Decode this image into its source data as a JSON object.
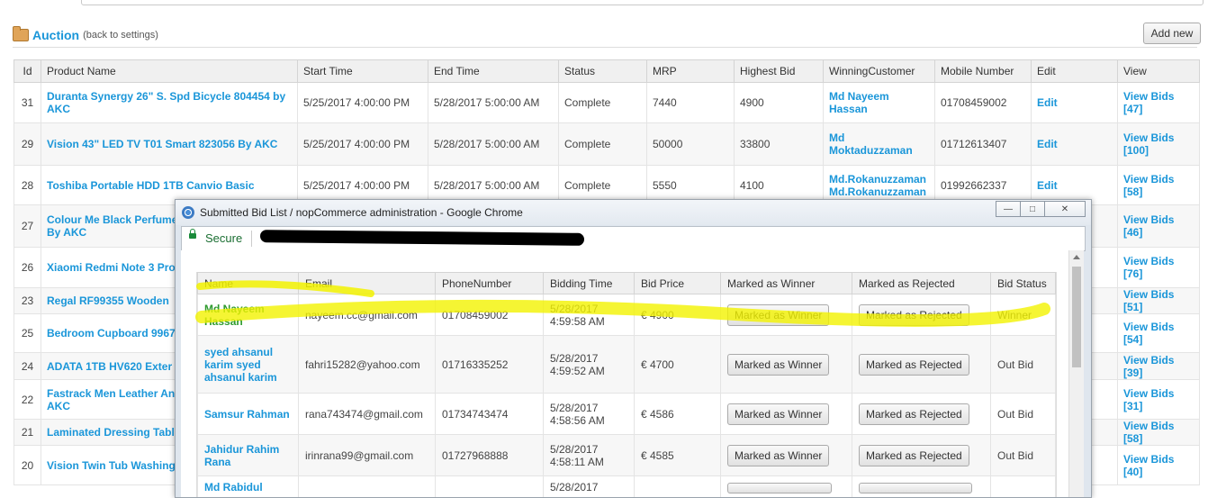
{
  "header": {
    "title": "Auction",
    "back_link": "(back to settings)",
    "add_new": "Add new"
  },
  "main_table": {
    "columns": [
      "Id",
      "Product Name",
      "Start Time",
      "End Time",
      "Status",
      "MRP",
      "Highest Bid",
      "WinningCustomer",
      "Mobile Number",
      "Edit",
      "View"
    ],
    "rows": [
      {
        "id": "31",
        "product": "Duranta Synergy 26\" S. Spd Bicycle 804454 by AKC",
        "start": "5/25/2017 4:00:00 PM",
        "end": "5/28/2017 5:00:00 AM",
        "status": "Complete",
        "mrp": "7440",
        "highest": "4900",
        "customer": "Md Nayeem Hassan",
        "mobile": "01708459002",
        "edit": "Edit",
        "view": "View Bids [47]"
      },
      {
        "id": "29",
        "product": "Vision 43\" LED TV T01 Smart 823056 By AKC",
        "start": "5/25/2017 4:00:00 PM",
        "end": "5/28/2017 5:00:00 AM",
        "status": "Complete",
        "mrp": "50000",
        "highest": "33800",
        "customer": "Md Moktaduzzaman",
        "mobile": "01712613407",
        "edit": "Edit",
        "view": "View Bids [100]"
      },
      {
        "id": "28",
        "product": "Toshiba Portable HDD 1TB Canvio Basic",
        "start": "5/25/2017 4:00:00 PM",
        "end": "5/28/2017 5:00:00 AM",
        "status": "Complete",
        "mrp": "5550",
        "highest": "4100",
        "customer": "Md.Rokanuzzaman Md.Rokanuzzaman",
        "mobile": "01992662337",
        "edit": "Edit",
        "view": "View Bids [58]"
      },
      {
        "id": "27",
        "product": "Colour Me Black Perfume COLOUR-PER-010 By AKC",
        "view": "View Bids [46]"
      },
      {
        "id": "26",
        "product": "Xiaomi Redmi Note 3 Pro AKC",
        "view": "View Bids [76]"
      },
      {
        "id": "23",
        "product": "Regal RF99355 Wooden",
        "view": "View Bids [51]"
      },
      {
        "id": "25",
        "product": "Bedroom Cupboard 9967",
        "view": "View Bids [54]"
      },
      {
        "id": "24",
        "product": "ADATA 1TB HV620 Exter",
        "view": "View Bids [39]"
      },
      {
        "id": "22",
        "product": "Fastrack Men Leather An NF3123SL02C By AKC",
        "view": "View Bids [31]"
      },
      {
        "id": "21",
        "product": "Laminated Dressing Table",
        "view": "View Bids [58]"
      },
      {
        "id": "20",
        "product": "Vision Twin Tub Washing By AKC",
        "view": "View Bids [40]"
      }
    ]
  },
  "popup": {
    "title": "Submitted Bid List / nopCommerce administration - Google Chrome",
    "secure_label": "Secure",
    "buttons": {
      "minimize": "—",
      "restore": "□",
      "close": "✕"
    },
    "columns": [
      "Name",
      "Email",
      "PhoneNumber",
      "Bidding Time",
      "Bid Price",
      "Marked as Winner",
      "Marked as Rejected",
      "Bid Status"
    ],
    "rows": [
      {
        "name": "Md Nayeem Hassan",
        "email": "nayeem.cc@gmail.com",
        "phone": "01708459002",
        "time": "5/28/2017 4:59:58 AM",
        "price": "€ 4900",
        "winner_btn": "Marked as Winner",
        "reject_btn": "Marked as Rejected",
        "status": "Winner"
      },
      {
        "name": "syed ahsanul karim syed ahsanul karim",
        "email": "fahri15282@yahoo.com",
        "phone": "01716335252",
        "time": "5/28/2017 4:59:52 AM",
        "price": "€ 4700",
        "winner_btn": "Marked as Winner",
        "reject_btn": "Marked as Rejected",
        "status": "Out Bid"
      },
      {
        "name": "Samsur Rahman",
        "email": "rana743474@gmail.com",
        "phone": "01734743474",
        "time": "5/28/2017 4:58:56 AM",
        "price": "€ 4586",
        "winner_btn": "Marked as Winner",
        "reject_btn": "Marked as Rejected",
        "status": "Out Bid"
      },
      {
        "name": "Jahidur Rahim Rana",
        "email": "irinrana99@gmail.com",
        "phone": "01727968888",
        "time": "5/28/2017 4:58:11 AM",
        "price": "€ 4585",
        "winner_btn": "Marked as Winner",
        "reject_btn": "Marked as Rejected",
        "status": "Out Bid"
      },
      {
        "name": "Md Rabidul",
        "time": "5/28/2017"
      }
    ]
  },
  "colors": {
    "link": "#1a96d9",
    "highlight": "#f2f200",
    "secure": "#1a8a3a"
  }
}
